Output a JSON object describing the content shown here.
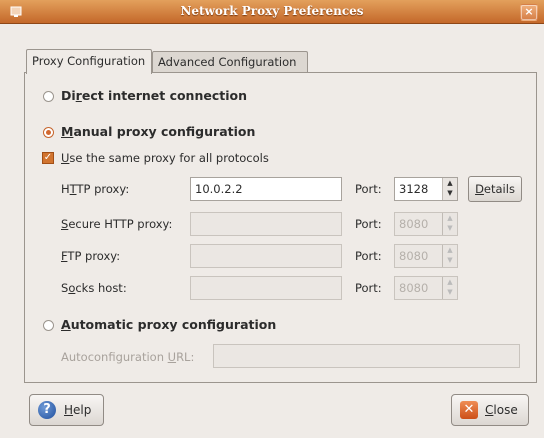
{
  "window": {
    "title": "Network Proxy Preferences",
    "close_glyph": "×"
  },
  "tabs": [
    {
      "label": "Proxy Configuration",
      "active": true
    },
    {
      "label": "Advanced Configuration",
      "active": false
    }
  ],
  "direct": {
    "prefix": "Di",
    "mnemonic": "r",
    "suffix": "ect internet connection",
    "selected": false
  },
  "manual": {
    "mnemonic": "M",
    "suffix": "anual proxy configuration",
    "selected": true
  },
  "same_proxy": {
    "mnemonic": "U",
    "suffix": "se the same proxy for all protocols",
    "checked": true
  },
  "rows": [
    {
      "prefix": "H",
      "mnemonic": "T",
      "suffix": "TP proxy:",
      "value": "10.0.2.2",
      "port_label": "Port:",
      "port": "3128",
      "enabled": true
    },
    {
      "prefix": "",
      "mnemonic": "S",
      "suffix": "ecure HTTP proxy:",
      "value": "",
      "port_label": "Port:",
      "port": "8080",
      "enabled": false
    },
    {
      "prefix": "",
      "mnemonic": "F",
      "suffix": "TP proxy:",
      "value": "",
      "port_label": "Port:",
      "port": "8080",
      "enabled": false
    },
    {
      "prefix": "S",
      "mnemonic": "o",
      "suffix": "cks host:",
      "value": "",
      "port_label": "Port:",
      "port": "8080",
      "enabled": false
    }
  ],
  "details_button": {
    "mnemonic": "D",
    "suffix": "etails"
  },
  "automatic": {
    "mnemonic": "A",
    "suffix": "utomatic proxy configuration",
    "selected": false
  },
  "autoconfig": {
    "prefix": "Autoconfiguration ",
    "mnemonic": "U",
    "suffix": "RL:",
    "value": ""
  },
  "footer": {
    "help": {
      "mnemonic": "H",
      "suffix": "elp",
      "icon": "help-icon"
    },
    "close": {
      "mnemonic": "C",
      "suffix": "lose",
      "icon": "close-icon"
    }
  },
  "colors": {
    "titlebar": "#c4682a",
    "accent": "#d2682f",
    "background": "#efebe7"
  }
}
